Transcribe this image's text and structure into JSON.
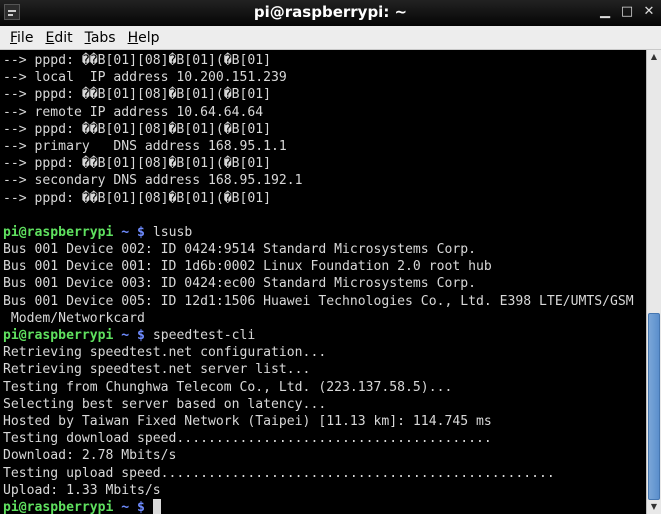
{
  "window": {
    "title": "pi@raspberrypi: ~"
  },
  "menu": [
    {
      "accel": "F",
      "rest": "ile"
    },
    {
      "accel": "E",
      "rest": "dit"
    },
    {
      "accel": "T",
      "rest": "abs"
    },
    {
      "accel": "H",
      "rest": "elp"
    }
  ],
  "terminal": {
    "prompt_user": "pi@raspberrypi",
    "prompt_path": "~",
    "prompt_symbol": "$",
    "lines": [
      {
        "text": "--> pppd: ��B[01][08]�B[01](�B[01]"
      },
      {
        "text": "--> local  IP address 10.200.151.239"
      },
      {
        "text": "--> pppd: ��B[01][08]�B[01](�B[01]"
      },
      {
        "text": "--> remote IP address 10.64.64.64"
      },
      {
        "text": "--> pppd: ��B[01][08]�B[01](�B[01]"
      },
      {
        "text": "--> primary   DNS address 168.95.1.1"
      },
      {
        "text": "--> pppd: ��B[01][08]�B[01](�B[01]"
      },
      {
        "text": "--> secondary DNS address 168.95.192.1"
      },
      {
        "text": "--> pppd: ��B[01][08]�B[01](�B[01]"
      },
      {
        "text": ""
      },
      {
        "prompt": true,
        "command": "lsusb"
      },
      {
        "text": "Bus 001 Device 002: ID 0424:9514 Standard Microsystems Corp."
      },
      {
        "text": "Bus 001 Device 001: ID 1d6b:0002 Linux Foundation 2.0 root hub"
      },
      {
        "text": "Bus 001 Device 003: ID 0424:ec00 Standard Microsystems Corp."
      },
      {
        "text": "Bus 001 Device 005: ID 12d1:1506 Huawei Technologies Co., Ltd. E398 LTE/UMTS/GSM"
      },
      {
        "text": " Modem/Networkcard"
      },
      {
        "prompt": true,
        "command": "speedtest-cli"
      },
      {
        "text": "Retrieving speedtest.net configuration..."
      },
      {
        "text": "Retrieving speedtest.net server list..."
      },
      {
        "text": "Testing from Chunghwa Telecom Co., Ltd. (223.137.58.5)..."
      },
      {
        "text": "Selecting best server based on latency..."
      },
      {
        "text": "Hosted by Taiwan Fixed Network (Taipei) [11.13 km]: 114.745 ms"
      },
      {
        "text": "Testing download speed........................................"
      },
      {
        "text": "Download: 2.78 Mbits/s"
      },
      {
        "text": "Testing upload speed.................................................."
      },
      {
        "text": "Upload: 1.33 Mbits/s"
      },
      {
        "prompt": true,
        "command": "",
        "cursor": true
      }
    ]
  },
  "scrollbar": {
    "thumb_start_fraction": 0.57,
    "thumb_size_fraction": 0.43
  },
  "colors": {
    "prompt_user": "#5fe05f",
    "prompt_path": "#6f8cff",
    "terminal_fg": "#d8d8d8",
    "terminal_bg": "#000000",
    "scroll_thumb": "#5b8fcc"
  },
  "icons": {
    "window_icon": "terminal-icon",
    "minimize": "minimize-icon",
    "maximize": "maximize-icon",
    "close": "close-icon"
  }
}
